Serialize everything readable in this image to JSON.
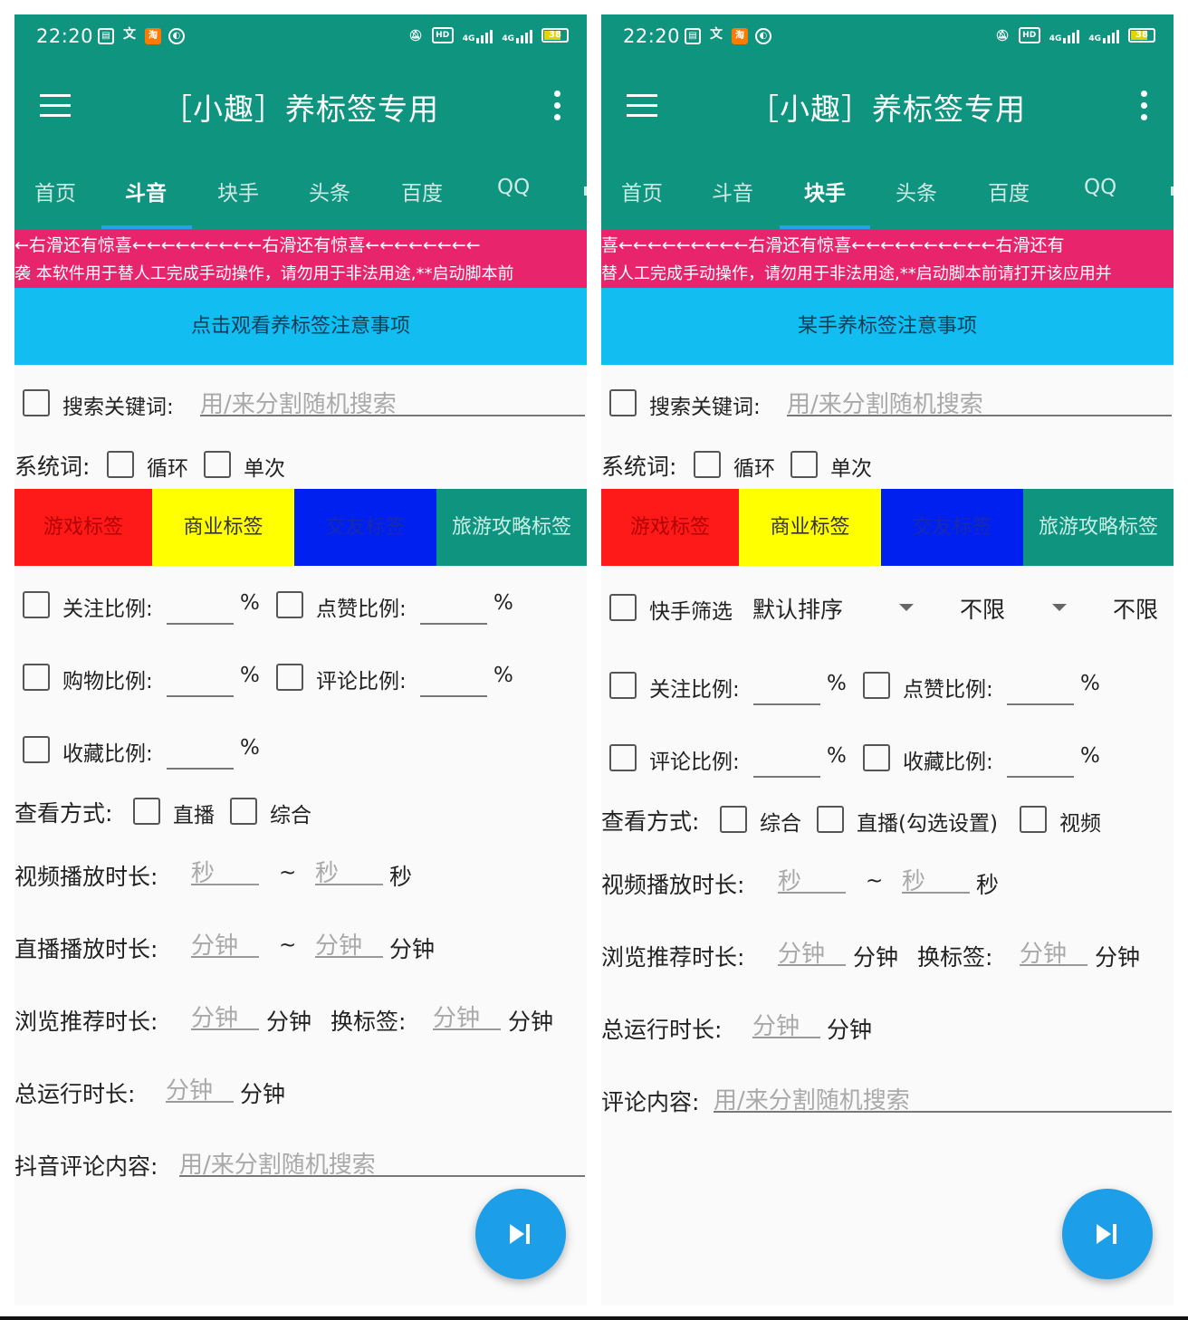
{
  "status": {
    "time": "22:20",
    "battery": "38",
    "signal": "4G",
    "hd_badge": "HD"
  },
  "app": {
    "title": "［小趣］养标签专用"
  },
  "tabs": [
    "首页",
    "斗音",
    "块手",
    "头条",
    "百度",
    "QQ"
  ],
  "tag_buttons": [
    {
      "label": "游戏标签",
      "bg": "#ff1a1a",
      "fg": "#b00000"
    },
    {
      "label": "商业标签",
      "bg": "#ffff00",
      "fg": "#333333"
    },
    {
      "label": "交友标签",
      "bg": "#0020f0",
      "fg": "#1a2ab0"
    },
    {
      "label": "旅游攻略标签",
      "bg": "#0f9480",
      "fg": "#c8efe6"
    }
  ],
  "left": {
    "active_tab": "斗音",
    "marquee": "←右滑还有惊喜←←←←←←←←←右滑还有惊喜←←←←←←←←",
    "disclaimer": "袭 本软件用于替人工完成手动操作，请勿用于非法用途,**启动脚本前",
    "notice": "点击观看养标签注意事项",
    "search_label": "搜索关键词:",
    "search_placeholder": "用/来分割随机搜索",
    "sys_label": "系统词:",
    "loop_label": "循环",
    "once_label": "单次",
    "follow_label": "关注比例:",
    "like_label": "点赞比例:",
    "shop_label": "购物比例:",
    "comment_ratio_label": "评论比例:",
    "fav_label": "收藏比例:",
    "percent": "%",
    "view_label": "查看方式:",
    "live_label": "直播",
    "mix_label": "综合",
    "video_dur_label": "视频播放时长:",
    "sec_placeholder": "秒",
    "tilde": "~",
    "sec_unit": "秒",
    "live_dur_label": "直播播放时长:",
    "min_placeholder": "分钟",
    "min_unit": "分钟",
    "browse_label": "浏览推荐时长:",
    "switch_tag_label": "换标签:",
    "total_label": "总运行时长:",
    "comment_content_label": "抖音评论内容:",
    "comment_placeholder": "用/来分割随机搜索"
  },
  "right": {
    "active_tab": "块手",
    "marquee": "喜←←←←←←←←←右滑还有惊喜←←←←←←←←←←右滑还有",
    "disclaimer": "替人工完成手动操作，请勿用于非法用途,**启动脚本前请打开该应用并",
    "notice": "某手养标签注意事项",
    "search_label": "搜索关键词:",
    "search_placeholder": "用/来分割随机搜索",
    "sys_label": "系统词:",
    "loop_label": "循环",
    "once_label": "单次",
    "filter_label": "快手筛选",
    "sort_value": "默认排序",
    "limit1_value": "不限",
    "limit2_value": "不限",
    "follow_label": "关注比例:",
    "like_label": "点赞比例:",
    "comment_ratio_label": "评论比例:",
    "fav_label": "收藏比例:",
    "percent": "%",
    "view_label": "查看方式:",
    "mix_label": "综合",
    "live_label": "直播(勾选设置)",
    "video_label": "视频",
    "video_dur_label": "视频播放时长:",
    "sec_placeholder": "秒",
    "tilde": "~",
    "sec_unit": "秒",
    "browse_label": "浏览推荐时长:",
    "min_placeholder": "分钟",
    "min_unit": "分钟",
    "switch_tag_label": "换标签:",
    "total_label": "总运行时长:",
    "comment_content_label": "评论内容:",
    "comment_placeholder": "用/来分割随机搜索"
  }
}
